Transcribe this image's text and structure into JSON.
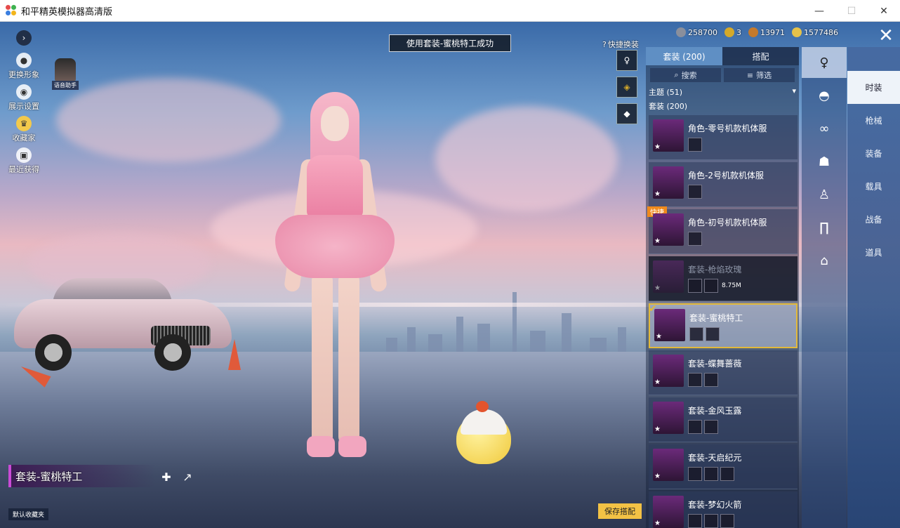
{
  "window": {
    "title": "和平精英模拟器高清版",
    "minimize": "—",
    "maximize": "☐",
    "close": "✕"
  },
  "left_menu": [
    {
      "label": "更换形象",
      "icon": "person-icon"
    },
    {
      "label": "展示设置",
      "icon": "eye-icon"
    },
    {
      "label": "收藏家",
      "icon": "crown-icon"
    },
    {
      "label": "最近获得",
      "icon": "gift-icon"
    }
  ],
  "voice_assistant": "语音助手",
  "toast": "使用套装-蜜桃特工成功",
  "currency": [
    {
      "value": "258700",
      "color": "#8a8f9c"
    },
    {
      "value": "3",
      "color": "#d4a92a"
    },
    {
      "value": "13971",
      "color": "#c57a2c"
    },
    {
      "value": "1577486",
      "color": "#e5c24a"
    }
  ],
  "quick_change_label": "快捷换装",
  "panel": {
    "tabs": [
      {
        "label": "套装 (200)",
        "active": true
      },
      {
        "label": "搭配",
        "active": false
      }
    ],
    "search": "搜索",
    "filter": "筛选",
    "theme_label": "主题 (51)",
    "suit_label": "套装 (200)",
    "items": [
      {
        "name": "角色-零号机款机体服",
        "state": "normal"
      },
      {
        "name": "角色-2号机款机体服",
        "state": "normal"
      },
      {
        "name": "角色-初号机款机体服",
        "state": "quick",
        "badge": "快捷"
      },
      {
        "name": "套装-枪焰玫瑰",
        "state": "dim",
        "size": "8.75M"
      },
      {
        "name": "套装-蜜桃特工",
        "state": "selected"
      },
      {
        "name": "套装-蝶舞蔷薇",
        "state": "normal"
      },
      {
        "name": "套装-金风玉露",
        "state": "normal"
      },
      {
        "name": "套装-天启纪元",
        "state": "normal"
      },
      {
        "name": "套装-梦幻火箭",
        "state": "normal"
      }
    ]
  },
  "categories": [
    {
      "icon": "outfit-icon",
      "active": true
    },
    {
      "icon": "hat-icon",
      "active": false
    },
    {
      "icon": "glasses-icon",
      "active": false
    },
    {
      "icon": "mask-icon",
      "active": false
    },
    {
      "icon": "top-icon",
      "active": false
    },
    {
      "icon": "pants-icon",
      "active": false
    },
    {
      "icon": "shoes-icon",
      "active": false
    }
  ],
  "main_nav": [
    {
      "label": "时装",
      "active": true
    },
    {
      "label": "枪械",
      "active": false
    },
    {
      "label": "装备",
      "active": false
    },
    {
      "label": "载具",
      "active": false
    },
    {
      "label": "战备",
      "active": false
    },
    {
      "label": "道具",
      "active": false
    }
  ],
  "outfit_name": "套装-蜜桃特工",
  "default_favorite": "默认收藏夹",
  "save_button": "保存搭配"
}
